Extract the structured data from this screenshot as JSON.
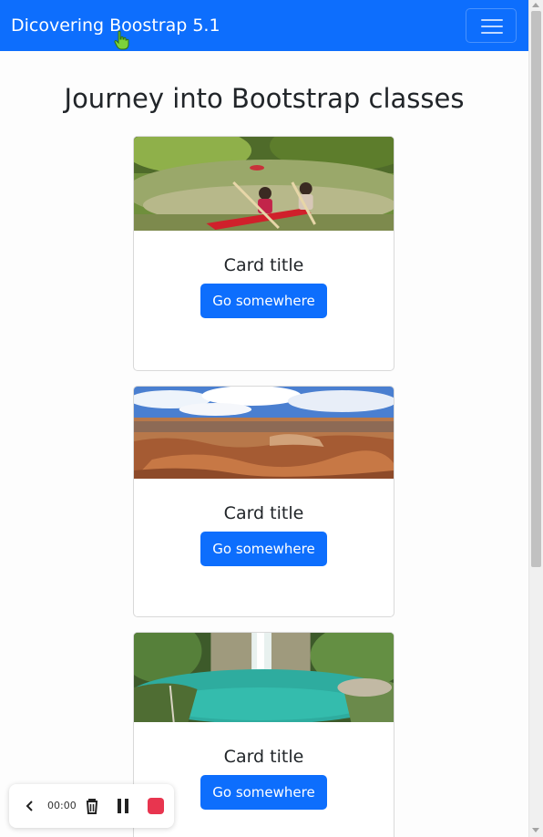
{
  "navbar": {
    "brand": "Dicovering Boostrap 5.1",
    "toggler_icon": "hamburger-menu-icon",
    "color": "#0d6efd"
  },
  "page": {
    "title": "Journey into Bootstrap classes"
  },
  "cards": [
    {
      "image": "kayaking-river-photo",
      "title": "Card title",
      "button_label": "Go somewhere"
    },
    {
      "image": "canyon-landscape-photo",
      "title": "Card title",
      "button_label": "Go somewhere"
    },
    {
      "image": "waterfall-lagoon-photo",
      "title": "Card title",
      "button_label": "Go somewhere"
    }
  ],
  "recorder": {
    "time": "00:00",
    "icons": [
      "chevron-left-icon",
      "trash-icon",
      "pause-icon",
      "stop-icon"
    ],
    "stop_color": "#e8354f"
  }
}
